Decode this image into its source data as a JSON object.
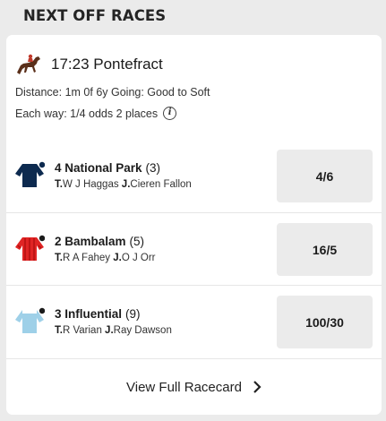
{
  "header": {
    "title": "NEXT OFF RACES"
  },
  "race": {
    "icon": "horse-racing-icon",
    "title": "17:23 Pontefract",
    "distance_line": "Distance: 1m 0f 6y Going: Good to Soft",
    "each_way_line": "Each way: 1/4 odds 2 places",
    "info_icon": "info-icon"
  },
  "runners": [
    {
      "name": "4 National Park",
      "draw": "(3)",
      "trainer_prefix": "T.",
      "trainer": "W J Haggas",
      "jockey_prefix": "J.",
      "jockey": "Cieren Fallon",
      "odds": "4/6",
      "silk_color": "#0d2a4f"
    },
    {
      "name": "2 Bambalam",
      "draw": "(5)",
      "trainer_prefix": "T.",
      "trainer": "R A Fahey",
      "jockey_prefix": "J.",
      "jockey": "O J Orr",
      "odds": "16/5",
      "silk_color": "#e02424"
    },
    {
      "name": "3 Influential",
      "draw": "(9)",
      "trainer_prefix": "T.",
      "trainer": "R Varian",
      "jockey_prefix": "J.",
      "jockey": "Ray Dawson",
      "odds": "100/30",
      "silk_color": "#9ed0e8"
    }
  ],
  "footer": {
    "label": "View Full Racecard",
    "icon": "chevron-right-icon"
  }
}
